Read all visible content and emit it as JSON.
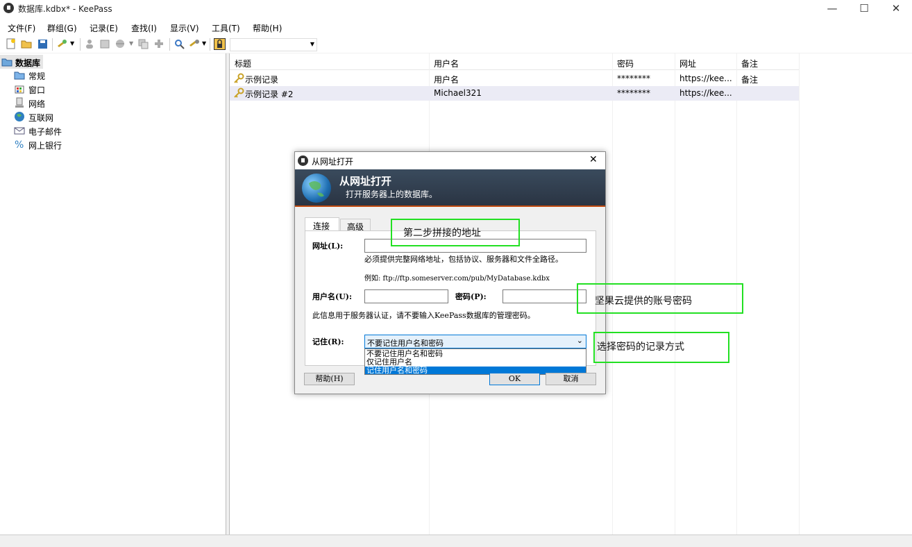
{
  "window": {
    "title": "数据库.kdbx* - KeePass",
    "minimize": "—",
    "maximize": "☐",
    "close": "✕"
  },
  "menu": [
    "文件(F)",
    "群组(G)",
    "记录(E)",
    "查找(I)",
    "显示(V)",
    "工具(T)",
    "帮助(H)"
  ],
  "tree": {
    "root": "数据库",
    "groups": [
      "常规",
      "窗口",
      "网络",
      "互联网",
      "电子邮件",
      "网上银行"
    ]
  },
  "list": {
    "columns": [
      "标题",
      "用户名",
      "密码",
      "网址",
      "备注"
    ],
    "rows": [
      {
        "title": "示例记录",
        "username": "用户名",
        "password": "********",
        "url": "https://kee...",
        "notes": "备注"
      },
      {
        "title": "示例记录 #2",
        "username": "Michael321",
        "password": "********",
        "url": "https://kee...",
        "notes": ""
      }
    ]
  },
  "dialog": {
    "title": "从网址打开",
    "close": "✕",
    "banner_title": "从网址打开",
    "banner_subtitle": "打开服务器上的数据库。",
    "tabs": [
      "连接",
      "高级"
    ],
    "url_label": "网址(L):",
    "url_value": "",
    "url_hint": "必须提供完整网络地址，包括协议、服务器和文件全路径。",
    "url_example": "例如: ftp://ftp.someserver.com/pub/MyDatabase.kdbx",
    "user_label": "用户名(U):",
    "user_value": "",
    "password_label": "密码(P):",
    "password_value": "",
    "auth_note": "此信息用于服务器认证，请不要输入KeePass数据库的管理密码。",
    "remember_label": "记住(R):",
    "remember_selected": "不要记住用户名和密码",
    "remember_options": [
      "不要记住用户名和密码",
      "仅记住用户名",
      "记住用户名和密码"
    ],
    "remember_highlighted": "记住用户名和密码",
    "help_button": "帮助(H)",
    "ok_button": "OK",
    "cancel_button": "取消"
  },
  "annotations": [
    "第二步拼接的地址",
    "坚果云提供的账号密码",
    "选择密码的记录方式"
  ],
  "colors": {
    "annotation_border": "#22e022",
    "selection": "#0078d7",
    "banner_accent": "#c24a0f"
  }
}
